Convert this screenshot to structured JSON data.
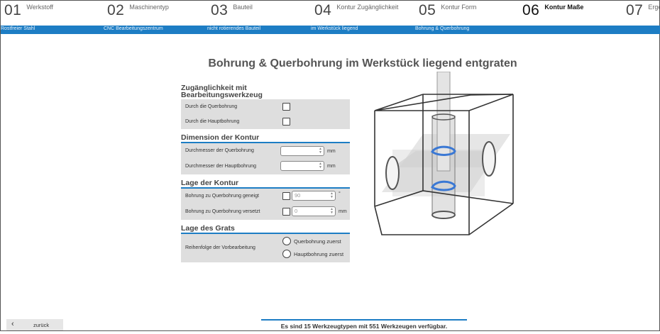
{
  "steps": [
    {
      "num": "01",
      "label": "Werkstoff",
      "selection": "Rostfreier Stahl"
    },
    {
      "num": "02",
      "label": "Maschinentyp",
      "selection": "CNC Bearbeitungszentrum"
    },
    {
      "num": "03",
      "label": "Bauteil",
      "selection": "nicht rotierendes Bauteil"
    },
    {
      "num": "04",
      "label": "Kontur Zugänglichkeit",
      "selection": "im Werkstück liegend"
    },
    {
      "num": "05",
      "label": "Kontur Form",
      "selection": "Bohrung & Querbohrung"
    },
    {
      "num": "06",
      "label": "Kontur Maße",
      "selection": ""
    },
    {
      "num": "07",
      "label": "Erge",
      "selection": ""
    }
  ],
  "active_step": "06",
  "page_title": "Bohrung & Querbohrung im Werkstück liegend entgraten",
  "sections": {
    "access": {
      "title_line1": "Zugänglichkeit mit",
      "title_line2": "Bearbeitungswerkzeug",
      "opt1": "Durch die Querbohrung",
      "opt2": "Durch die Hauptbohrung"
    },
    "dimension": {
      "title": "Dimension der Kontur",
      "d_quer": "Durchmesser der Querbohrung",
      "d_haupt": "Durchmesser der Hauptbohrung",
      "unit": "mm"
    },
    "position": {
      "title": "Lage der Kontur",
      "tilted": "Bohrung zu Querbohrung geneigt",
      "tilted_value": "90",
      "tilted_unit": "°",
      "offset": "Bohrung zu Querbohrung versetzt",
      "offset_value": "0",
      "offset_unit": "mm"
    },
    "burr": {
      "title": "Lage des Grats",
      "order_label": "Reihenfolge der Vorbearbeitung",
      "opt1": "Querbohrung zuerst",
      "opt2": "Hauptbohrung zuerst"
    }
  },
  "back_label": "zurück",
  "status_text": "Es sind 15 Werkzeugtypen mit 551 Werkzeugen verfügbar.",
  "colors": {
    "accent": "#1d7dc4",
    "panel": "#dedede",
    "highlight": "#3a78d4"
  }
}
